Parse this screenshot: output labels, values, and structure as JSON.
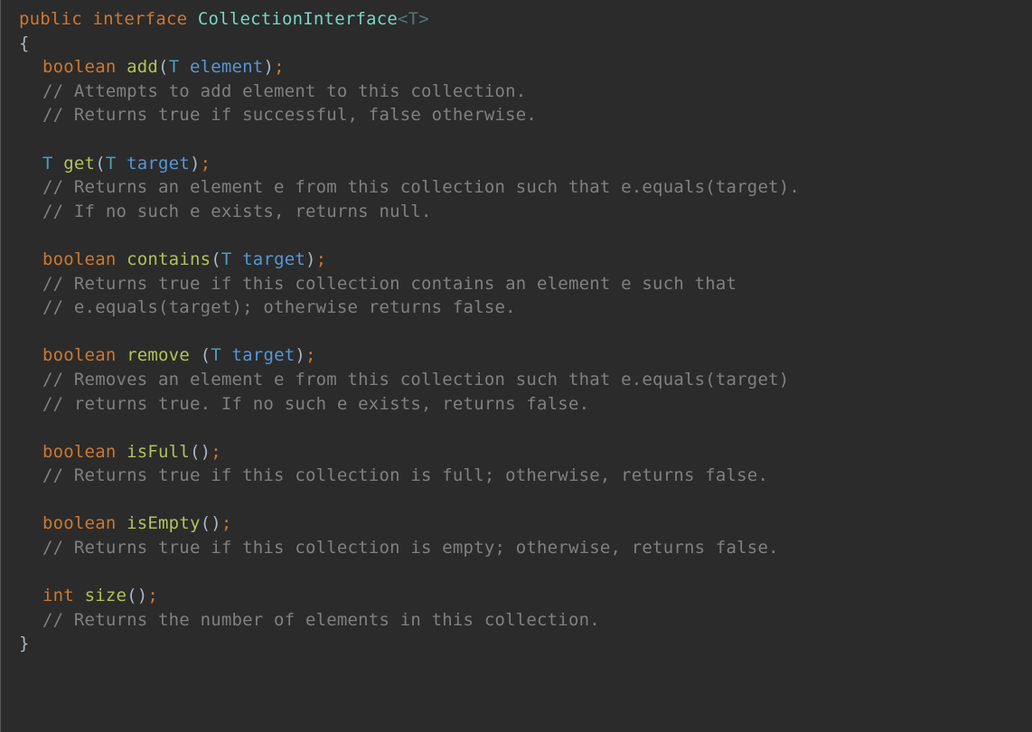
{
  "code": {
    "line1": {
      "kw_public": "public",
      "kw_interface": "interface",
      "classname": "CollectionInterface",
      "generic_open": "<",
      "generic_t": "T",
      "generic_close": ">"
    },
    "brace_open": "{",
    "brace_close": "}",
    "add": {
      "ret": "boolean",
      "name": "add",
      "paren_open": "(",
      "ptype": "T",
      "pname": "element",
      "paren_close": ")",
      "semi": ";",
      "c1": "// Attempts to add element to this collection.",
      "c2": "// Returns true if successful, false otherwise."
    },
    "get": {
      "ret": "T",
      "name": "get",
      "paren_open": "(",
      "ptype": "T",
      "pname": "target",
      "paren_close": ")",
      "semi": ";",
      "c1": "// Returns an element e from this collection such that e.equals(target).",
      "c2": "// If no such e exists, returns null."
    },
    "contains": {
      "ret": "boolean",
      "name": "contains",
      "paren_open": "(",
      "ptype": "T",
      "pname": "target",
      "paren_close": ")",
      "semi": ";",
      "c1": "// Returns true if this collection contains an element e such that",
      "c2": "// e.equals(target); otherwise returns false."
    },
    "remove": {
      "ret": "boolean",
      "name": "remove",
      "space": " ",
      "paren_open": "(",
      "ptype": "T",
      "pname": "target",
      "paren_close": ")",
      "semi": ";",
      "c1": "// Removes an element e from this collection such that e.equals(target)",
      "c2": "// returns true. If no such e exists, returns false."
    },
    "isFull": {
      "ret": "boolean",
      "name": "isFull",
      "paren_open": "(",
      "paren_close": ")",
      "semi": ";",
      "c1": "// Returns true if this collection is full; otherwise, returns false."
    },
    "isEmpty": {
      "ret": "boolean",
      "name": "isEmpty",
      "paren_open": "(",
      "paren_close": ")",
      "semi": ";",
      "c1": "// Returns true if this collection is empty; otherwise, returns false."
    },
    "size": {
      "ret": "int",
      "name": "size",
      "paren_open": "(",
      "paren_close": ")",
      "semi": ";",
      "c1": "// Returns the number of elements in this collection."
    }
  }
}
